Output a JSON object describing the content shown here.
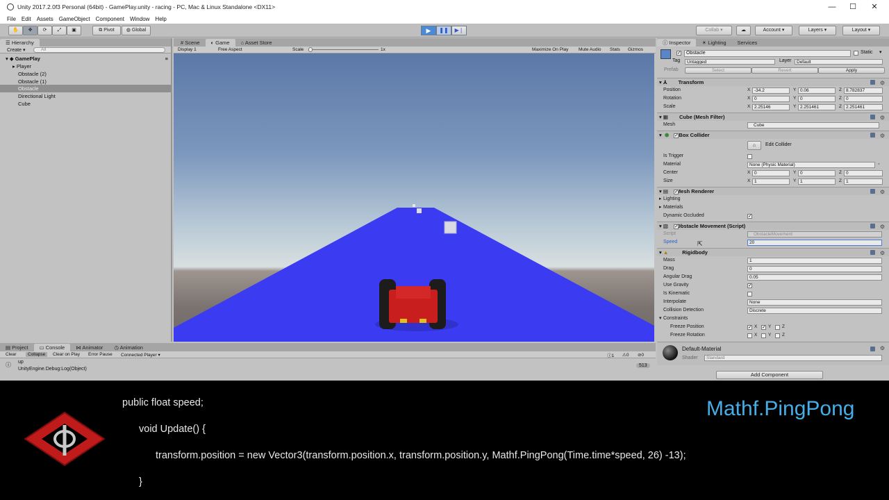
{
  "window": {
    "title": "Unity 2017.2.0f3 Personal (64bit) - GamePlay.unity - racing - PC, Mac & Linux Standalone <DX11>",
    "minimize": "—",
    "maximize": "☐",
    "close": "✕"
  },
  "menu": [
    "File",
    "Edit",
    "Assets",
    "GameObject",
    "Component",
    "Window",
    "Help"
  ],
  "toolbar": {
    "pivot": "Pivot",
    "global": "Global",
    "collab": "Collab ▾",
    "account": "Account",
    "layers": "Layers",
    "layout": "Layout"
  },
  "hierarchy": {
    "tab": "Hierarchy",
    "create": "Create ▾",
    "search_placeholder": "All",
    "scene": "GamePlay",
    "items": [
      "Player",
      "Obstacle (2)",
      "Obstacle (1)",
      "Obstacle",
      "Directional Light",
      "Cube"
    ],
    "selected_index": 3
  },
  "game": {
    "tabs": [
      "Scene",
      "Game",
      "Asset Store"
    ],
    "display": "Display 1",
    "aspect": "Free Aspect",
    "scale_label": "Scale",
    "scale_value": "1x",
    "maximize_on_play": "Maximize On Play",
    "mute_audio": "Mute Audio",
    "stats": "Stats",
    "gizmos": "Gizmos"
  },
  "inspector": {
    "tabs": [
      "Inspector",
      "Lighting",
      "Services"
    ],
    "object_name": "Obstacle",
    "static_label": "Static",
    "tag_label": "Tag",
    "tag_value": "Untagged",
    "layer_label": "Layer",
    "layer_value": "Default",
    "prefab_label": "Prefab",
    "prefab_select": "Select",
    "prefab_revert": "Revert",
    "prefab_apply": "Apply",
    "transform": {
      "title": "Transform",
      "position_label": "Position",
      "position": [
        "-34.2",
        "0.06",
        "8.782837"
      ],
      "rotation_label": "Rotation",
      "rotation": [
        "0",
        "0",
        "0"
      ],
      "scale_label": "Scale",
      "scale": [
        "2.25146",
        "2.251461",
        "2.251461"
      ]
    },
    "mesh_filter": {
      "title": "Cube (Mesh Filter)",
      "mesh_label": "Mesh",
      "mesh_value": "Cube"
    },
    "box_collider": {
      "title": "Box Collider",
      "edit_collider": "Edit Collider",
      "is_trigger": "Is Trigger",
      "material_label": "Material",
      "material_value": "None (Physic Material)",
      "center_label": "Center",
      "center": [
        "0",
        "0",
        "0"
      ],
      "size_label": "Size",
      "size": [
        "1",
        "1",
        "1"
      ]
    },
    "mesh_renderer": {
      "title": "Mesh Renderer",
      "lighting": "Lighting",
      "materials": "Materials",
      "dynamic_occluded": "Dynamic Occluded"
    },
    "obstacle_movement": {
      "title": "Obstacle Movement (Script)",
      "script_label": "Script",
      "script_value": "ObstacleMovement",
      "speed_label": "Speed",
      "speed_value": "20"
    },
    "rigidbody": {
      "title": "Rigidbody",
      "mass_label": "Mass",
      "mass": "1",
      "drag_label": "Drag",
      "drag": "0",
      "angular_drag_label": "Angular Drag",
      "angular_drag": "0.05",
      "use_gravity": "Use Gravity",
      "is_kinematic": "Is Kinematic",
      "interpolate_label": "Interpolate",
      "interpolate": "None",
      "collision_label": "Collision Detection",
      "collision": "Discrete",
      "constraints": "Constraints",
      "freeze_position": "Freeze Position",
      "freeze_rotation": "Freeze Rotation",
      "x": "X",
      "y": "Y",
      "z": "Z"
    },
    "material": {
      "name": "Default-Material",
      "shader_label": "Shader",
      "shader": "Standard"
    },
    "add_component": "Add Component"
  },
  "console": {
    "tabs": [
      "Project",
      "Console",
      "Animator",
      "Animation"
    ],
    "buttons": [
      "Clear",
      "Collapse",
      "Clear on Play",
      "Error Pause",
      "Connected Player ▾"
    ],
    "log_line1": "up",
    "log_line2": "UnityEngine.Debug:Log(Object)",
    "count": "513",
    "msg_count": "1",
    "warn_count": "0",
    "err_count": "0"
  },
  "overlay": {
    "code": [
      "public float speed;",
      "void Update() {",
      "transform.position = new Vector3(transform.position.x, transform.position.y, Mathf.PingPong(Time.time*speed, 26) -13);",
      "}"
    ],
    "brand": "Mathf.PingPong"
  },
  "colors": {
    "track": "#3b3cf2",
    "car_body": "#c81e1e",
    "brand": "#46aee6",
    "logo_red": "#c01b1b"
  }
}
